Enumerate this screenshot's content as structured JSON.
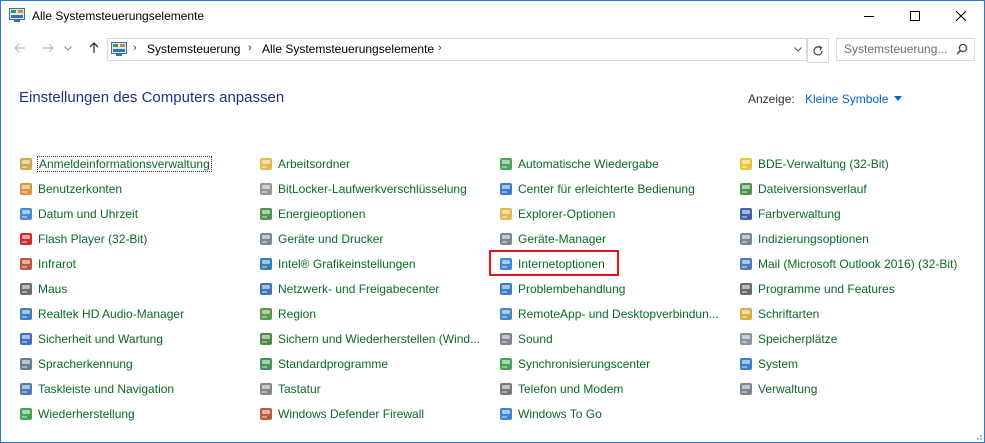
{
  "window": {
    "title": "Alle Systemsteuerungselemente",
    "controls": {
      "minimize_icon": "minimize-icon",
      "maximize_icon": "maximize-icon",
      "close_icon": "close-icon"
    }
  },
  "address": {
    "crumbs": [
      "Systemsteuerung",
      "Alle Systemsteuerungselemente"
    ],
    "search_placeholder": "Systemsteuerung..."
  },
  "header": {
    "title": "Einstellungen des Computers anpassen",
    "view_label": "Anzeige:",
    "view_value": "Kleine Symbole"
  },
  "columns": [
    {
      "items": [
        {
          "label": "Anmeldeinformationsverwaltung",
          "icon": "credential-manager-icon",
          "color": "#c8a13c"
        },
        {
          "label": "Benutzerkonten",
          "icon": "user-accounts-icon",
          "color": "#d58a2c"
        },
        {
          "label": "Datum und Uhrzeit",
          "icon": "date-time-icon",
          "color": "#3a7cc9"
        },
        {
          "label": "Flash Player (32-Bit)",
          "icon": "flash-player-icon",
          "color": "#c4161c"
        },
        {
          "label": "Infrarot",
          "icon": "infrared-icon",
          "color": "#b8442d"
        },
        {
          "label": "Maus",
          "icon": "mouse-icon",
          "color": "#555d66"
        },
        {
          "label": "Realtek HD Audio-Manager",
          "icon": "audio-manager-icon",
          "color": "#2d6db7"
        },
        {
          "label": "Sicherheit und Wartung",
          "icon": "flag-icon",
          "color": "#2b5fb8"
        },
        {
          "label": "Spracherkennung",
          "icon": "microphone-icon",
          "color": "#5b6e86"
        },
        {
          "label": "Taskleiste und Navigation",
          "icon": "taskbar-icon",
          "color": "#3d6fa8"
        },
        {
          "label": "Wiederherstellung",
          "icon": "recovery-icon",
          "color": "#2f9a44"
        }
      ]
    },
    {
      "items": [
        {
          "label": "Arbeitsordner",
          "icon": "work-folders-icon",
          "color": "#e3b23c"
        },
        {
          "label": "BitLocker-Laufwerkverschlüsselung",
          "icon": "bitlocker-icon",
          "color": "#8c8c8c"
        },
        {
          "label": "Energieoptionen",
          "icon": "power-options-icon",
          "color": "#3c8a3c"
        },
        {
          "label": "Geräte und Drucker",
          "icon": "devices-printers-icon",
          "color": "#6a7a8c"
        },
        {
          "label": "Intel® Grafikeinstellungen",
          "icon": "intel-graphics-icon",
          "color": "#1f6fb5"
        },
        {
          "label": "Netzwerk- und Freigabecenter",
          "icon": "network-icon",
          "color": "#2a66b0"
        },
        {
          "label": "Region",
          "icon": "region-icon",
          "color": "#4b8c3a"
        },
        {
          "label": "Sichern und Wiederherstellen (Wind...",
          "icon": "backup-icon",
          "color": "#3d7a3d"
        },
        {
          "label": "Standardprogramme",
          "icon": "default-programs-icon",
          "color": "#2f8a4a"
        },
        {
          "label": "Tastatur",
          "icon": "keyboard-icon",
          "color": "#7a7a7a"
        },
        {
          "label": "Windows Defender Firewall",
          "icon": "firewall-icon",
          "color": "#b54a2a"
        }
      ]
    },
    {
      "items": [
        {
          "label": "Automatische Wiedergabe",
          "icon": "autoplay-icon",
          "color": "#3a9a4a"
        },
        {
          "label": "Center für erleichterte Bedienung",
          "icon": "ease-of-access-icon",
          "color": "#2a6ec2"
        },
        {
          "label": "Explorer-Optionen",
          "icon": "explorer-options-icon",
          "color": "#e0b040"
        },
        {
          "label": "Geräte-Manager",
          "icon": "device-manager-icon",
          "color": "#6b7b8b"
        },
        {
          "label": "Internetoptionen",
          "icon": "internet-options-icon",
          "color": "#2a7bd0"
        },
        {
          "label": "Problembehandlung",
          "icon": "troubleshooting-icon",
          "color": "#2a6ec2"
        },
        {
          "label": "RemoteApp- und Desktopverbindun...",
          "icon": "remoteapp-icon",
          "color": "#3a7ab8"
        },
        {
          "label": "Sound",
          "icon": "sound-icon",
          "color": "#6c7480"
        },
        {
          "label": "Synchronisierungscenter",
          "icon": "sync-center-icon",
          "color": "#2f9a44"
        },
        {
          "label": "Telefon und Modem",
          "icon": "phone-modem-icon",
          "color": "#6a6a6a"
        },
        {
          "label": "Windows To Go",
          "icon": "windows-to-go-icon",
          "color": "#2a78d0"
        }
      ]
    },
    {
      "items": [
        {
          "label": "BDE-Verwaltung (32-Bit)",
          "icon": "bde-icon",
          "color": "#e8c020"
        },
        {
          "label": "Dateiversionsverlauf",
          "icon": "file-history-icon",
          "color": "#3a8a3a"
        },
        {
          "label": "Farbverwaltung",
          "icon": "color-management-icon",
          "color": "#2b4fa0"
        },
        {
          "label": "Indizierungsoptionen",
          "icon": "indexing-icon",
          "color": "#6a7a8a"
        },
        {
          "label": "Mail (Microsoft Outlook 2016) (32-Bit)",
          "icon": "mail-icon",
          "color": "#3a6eb0"
        },
        {
          "label": "Programme und Features",
          "icon": "programs-features-icon",
          "color": "#5a5a5a"
        },
        {
          "label": "Schriftarten",
          "icon": "fonts-icon",
          "color": "#d4a830"
        },
        {
          "label": "Speicherplätze",
          "icon": "storage-spaces-icon",
          "color": "#7a8a9a"
        },
        {
          "label": "System",
          "icon": "system-icon",
          "color": "#2a70c0"
        },
        {
          "label": "Verwaltung",
          "icon": "administration-icon",
          "color": "#6a7a8a"
        }
      ]
    }
  ],
  "highlighted_item": "Internetoptionen",
  "link_color": "#0b6a25",
  "heading_color": "#1e3287",
  "highlight_color": "#e0121e"
}
